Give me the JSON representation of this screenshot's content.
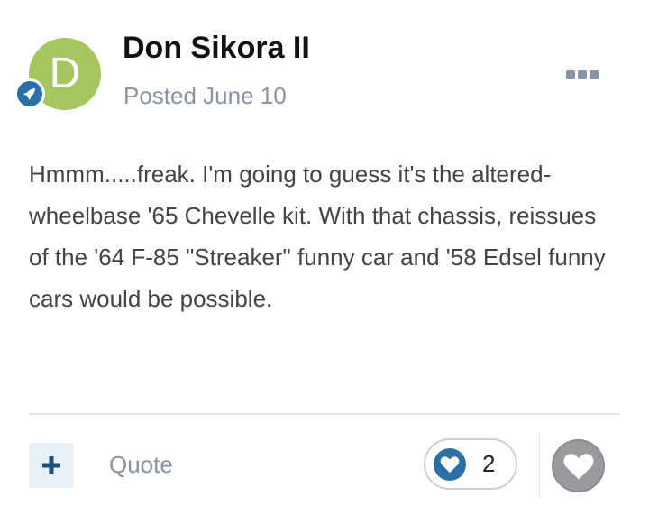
{
  "post": {
    "author": "Don Sikora II",
    "avatar_letter": "D",
    "avatar_color": "#a6c65f",
    "rank_icon": "rocket-icon",
    "posted": "Posted June 10",
    "body": "Hmmm.....freak. I'm going to guess it's the altered-wheelbase '65 Chevelle kit. With that chassis, reissues of the '64 F-85 \"Streaker\" funny car and '58 Edsel funny cars would be possible."
  },
  "actions": {
    "quote_label": "Quote",
    "reaction_count": "2"
  },
  "colors": {
    "accent": "#2b6fa8",
    "muted_text": "#8a93a1"
  }
}
